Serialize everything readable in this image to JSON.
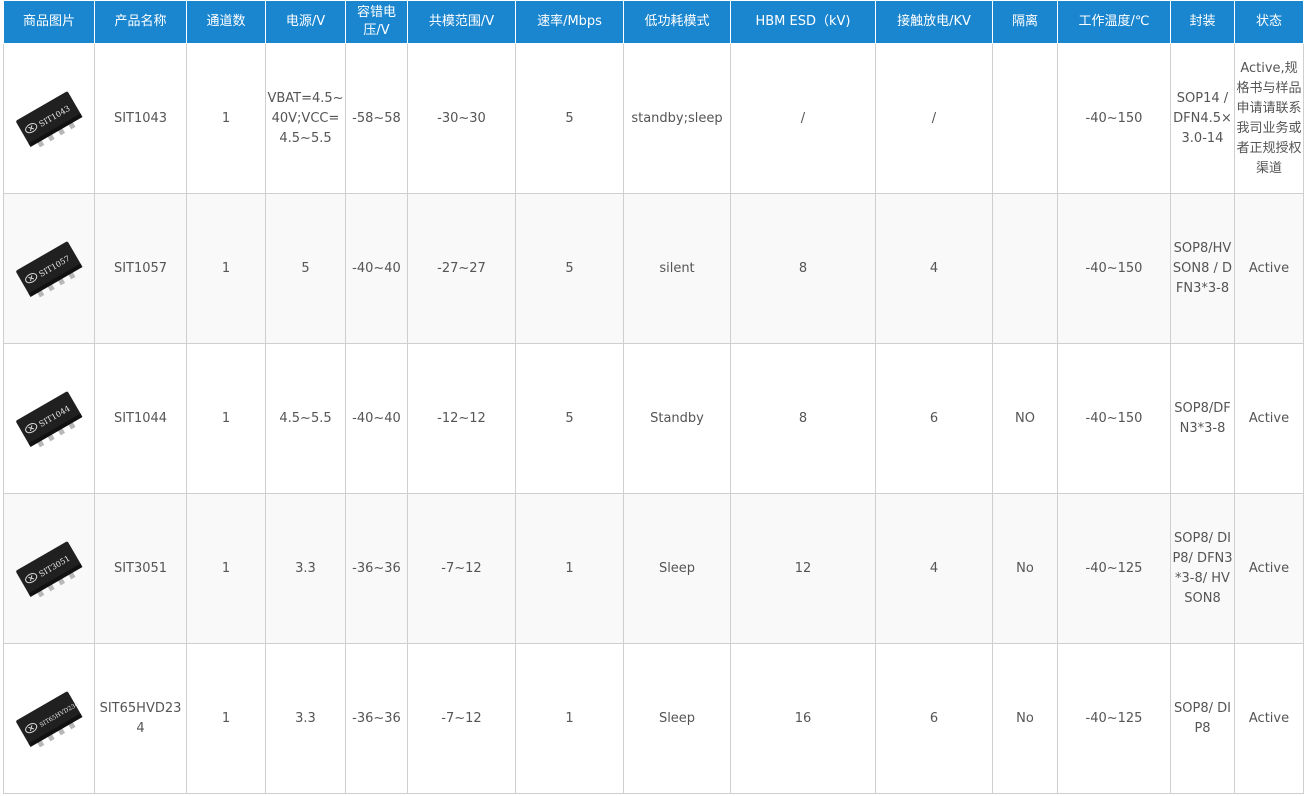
{
  "table": {
    "headers": [
      "商品图片",
      "产品名称",
      "通道数",
      "电源/V",
      "容错电压/V",
      "共模范围/V",
      "速率/Mbps",
      "低功耗模式",
      "HBM ESD（kV)",
      "接触放电/KV",
      "隔离",
      "工作温度/℃",
      "封装",
      "状态"
    ],
    "rows": [
      {
        "chip_mark": "SIT1043",
        "name": "SIT1043",
        "channels": "1",
        "supply": "VBAT=4.5~40V;VCC=4.5~5.5",
        "fault": "-58~58",
        "common_mode": "-30~30",
        "rate": "5",
        "low_power": "standby;sleep",
        "hbm_esd": "/",
        "contact": "/",
        "isolation": "",
        "temp": "-40~150",
        "package": "SOP14 / DFN4.5×3.0-14",
        "status": "Active,规格书与样品申请请联系我司业务或者正规授权渠道"
      },
      {
        "chip_mark": "SIT1057",
        "name": "SIT1057",
        "channels": "1",
        "supply": "5",
        "fault": "-40~40",
        "common_mode": "-27~27",
        "rate": "5",
        "low_power": "silent",
        "hbm_esd": "8",
        "contact": "4",
        "isolation": "",
        "temp": "-40~150",
        "package": "SOP8/HVSON8 / DFN3*3-8",
        "status": "Active"
      },
      {
        "chip_mark": "SIT1044",
        "name": "SIT1044",
        "channels": "1",
        "supply": "4.5~5.5",
        "fault": "-40~40",
        "common_mode": "-12~12",
        "rate": "5",
        "low_power": "Standby",
        "hbm_esd": "8",
        "contact": "6",
        "isolation": "NO",
        "temp": "-40~150",
        "package": "SOP8/DFN3*3-8",
        "status": "Active"
      },
      {
        "chip_mark": "SIT3051",
        "name": "SIT3051",
        "channels": "1",
        "supply": "3.3",
        "fault": "-36~36",
        "common_mode": "-7~12",
        "rate": "1",
        "low_power": "Sleep",
        "hbm_esd": "12",
        "contact": "4",
        "isolation": "No",
        "temp": "-40~125",
        "package": "SOP8/ DIP8/ DFN3*3-8/ HVSON8",
        "status": "Active"
      },
      {
        "chip_mark": "SIT65HVD234",
        "name": "SIT65HVD234",
        "channels": "1",
        "supply": "3.3",
        "fault": "-36~36",
        "common_mode": "-7~12",
        "rate": "1",
        "low_power": "Sleep",
        "hbm_esd": "16",
        "contact": "6",
        "isolation": "No",
        "temp": "-40~125",
        "package": "SOP8/ DIP8",
        "status": "Active"
      }
    ]
  },
  "colors": {
    "header_bg": "#1a86d0",
    "header_text": "#ffffff",
    "cell_text": "#555555",
    "border": "#cfcfcf"
  },
  "icons": {
    "chip_image": "chip-icon",
    "logo_mark": "sit-logo-icon"
  }
}
